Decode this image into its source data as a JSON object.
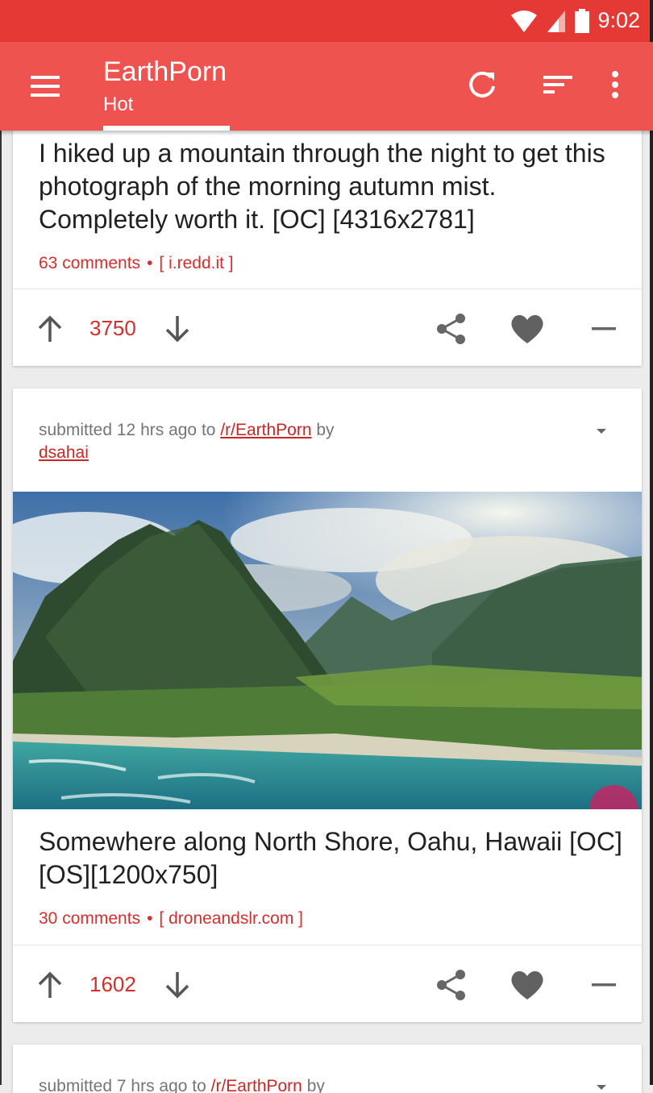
{
  "status_bar": {
    "time": "9:02",
    "icons": [
      "wifi-icon",
      "signal-icon",
      "battery-icon"
    ],
    "color": "#e53935"
  },
  "app_bar": {
    "title": "EarthPorn",
    "subtitle": "Hot",
    "color": "#ef5350",
    "actions": [
      "menu-icon",
      "refresh-icon",
      "sort-icon",
      "more-vert-icon"
    ]
  },
  "posts": [
    {
      "title": "I hiked up a mountain through the night to get this photograph of the morning autumn mist. Completely worth it. [OC] [4316x2781]",
      "comments": "63 comments",
      "separator": "•",
      "domain": "[ i.redd.it ]",
      "score": "3750"
    },
    {
      "submitted_prefix": "submitted 12 hrs ago to",
      "subreddit": "/r/EarthPorn",
      "by": "by",
      "author": "dsahai",
      "title": "Somewhere along North Shore, Oahu, Hawaii [OC][OS][1200x750]",
      "comments": "30 comments",
      "separator": "•",
      "domain": "[ droneandslr.com ]",
      "score": "1602"
    },
    {
      "submitted_prefix": "submitted 7 hrs ago to",
      "subreddit": "/r/EarthPorn",
      "by": "by"
    }
  ],
  "accent_color": "#d32f2f"
}
